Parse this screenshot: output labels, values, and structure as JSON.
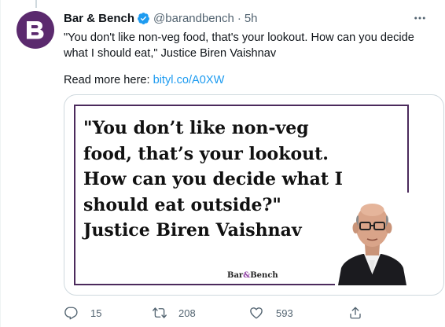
{
  "tweet": {
    "display_name": "Bar & Bench",
    "handle": "@barandbench",
    "separator": "·",
    "time": "5h",
    "text": "\"You don't like non-veg food, that's your lookout. How can you decide what I should eat,\" Justice Biren Vaishnav",
    "read_more_label": "Read more here: ",
    "link_text": "bityl.co/A0XW"
  },
  "media": {
    "quote_lines": [
      "\"You don’t like non-veg",
      "food, that’s your lookout.",
      "How can you decide what I",
      "should eat outside?\"",
      "Justice Biren Vaishnav"
    ],
    "brand_left": "Bar",
    "brand_sep": "&",
    "brand_right": "Bench"
  },
  "actions": {
    "reply_count": "15",
    "retweet_count": "208",
    "like_count": "593"
  },
  "icons": {
    "avatar": "bar-and-bench-logo",
    "verified": "verified-badge-icon",
    "more": "more-horizontal-icon",
    "reply": "reply-icon",
    "retweet": "retweet-icon",
    "like": "heart-icon",
    "share": "share-icon"
  },
  "colors": {
    "brand_purple": "#5b2a6e",
    "link_blue": "#1d9bf0",
    "muted": "#536471"
  }
}
